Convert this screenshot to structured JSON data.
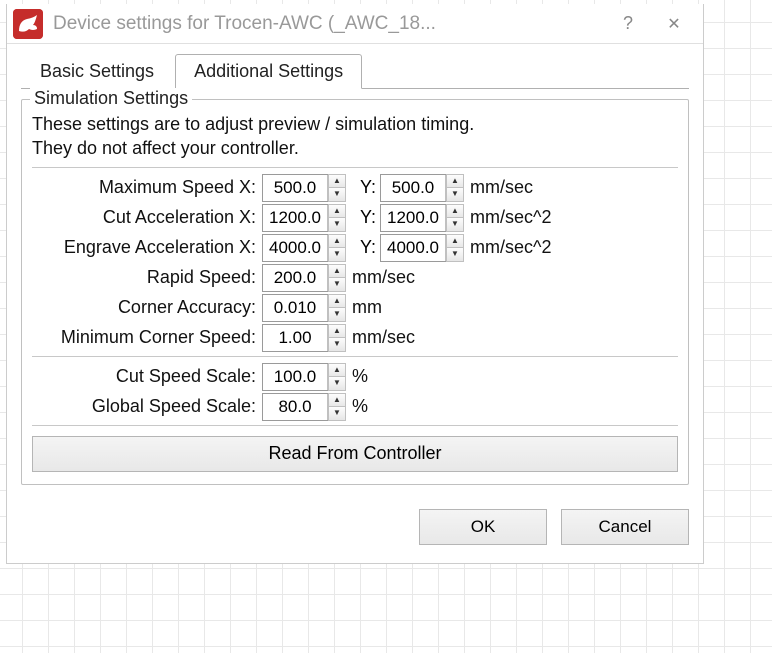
{
  "titlebar": {
    "title": "Device settings for Trocen-AWC (_AWC_18...",
    "help_label": "?",
    "close_label": "✕"
  },
  "tabs": {
    "basic": "Basic Settings",
    "additional": "Additional Settings"
  },
  "group": {
    "title": "Simulation Settings",
    "desc_line1": "These settings are to adjust preview / simulation timing.",
    "desc_line2": "They do not affect your controller."
  },
  "labels": {
    "max_speed_x": "Maximum Speed X:",
    "cut_accel_x": "Cut Acceleration X:",
    "engrave_accel_x": "Engrave Acceleration X:",
    "y": "Y:",
    "rapid_speed": "Rapid Speed:",
    "corner_accuracy": "Corner Accuracy:",
    "min_corner_speed": "Minimum Corner Speed:",
    "cut_speed_scale": "Cut Speed Scale:",
    "global_speed_scale": "Global Speed Scale:"
  },
  "values": {
    "max_speed_x": "500.0",
    "max_speed_y": "500.0",
    "cut_accel_x": "1200.0",
    "cut_accel_y": "1200.0",
    "engrave_accel_x": "4000.0",
    "engrave_accel_y": "4000.0",
    "rapid_speed": "200.0",
    "corner_accuracy": "0.010",
    "min_corner_speed": "1.00",
    "cut_speed_scale": "100.0",
    "global_speed_scale": "80.0"
  },
  "units": {
    "mm_sec": "mm/sec",
    "mm_sec2": "mm/sec^2",
    "mm": "mm",
    "percent": "%"
  },
  "buttons": {
    "read": "Read From Controller",
    "ok": "OK",
    "cancel": "Cancel"
  }
}
